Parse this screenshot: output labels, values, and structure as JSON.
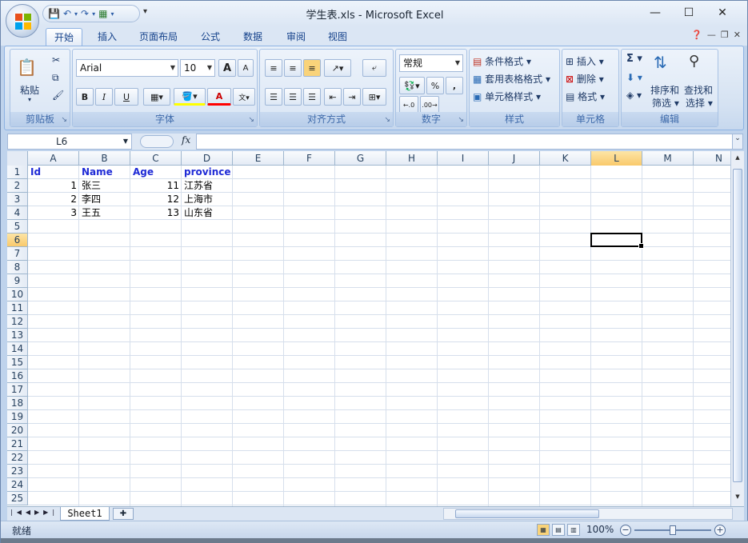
{
  "window": {
    "title": "学生表.xls - Microsoft Excel",
    "min": "—",
    "max": "☐",
    "close": "✕"
  },
  "ribbon": {
    "tabs": [
      "开始",
      "插入",
      "页面布局",
      "公式",
      "数据",
      "审阅",
      "视图"
    ],
    "active_tab": "开始",
    "groups": {
      "clipboard": {
        "label": "剪贴板",
        "paste": "粘贴"
      },
      "font": {
        "label": "字体",
        "font_name": "Arial",
        "font_size": "10",
        "bold": "B",
        "italic": "I",
        "underline": "U",
        "grow": "A",
        "shrink": "A",
        "font_color_letter": "A"
      },
      "alignment": {
        "label": "对齐方式"
      },
      "number": {
        "label": "数字",
        "format": "常规",
        "percent": "%",
        "comma": ","
      },
      "styles": {
        "label": "样式",
        "conditional": "条件格式",
        "table": "套用表格格式",
        "cell_styles": "单元格样式"
      },
      "cells": {
        "label": "单元格",
        "insert": "插入",
        "delete": "删除",
        "format": "格式"
      },
      "editing": {
        "label": "编辑",
        "sort": "排序和",
        "sort2": "筛选",
        "find": "查找和",
        "find2": "选择",
        "sigma": "Σ"
      }
    }
  },
  "formula_bar": {
    "name_box": "L6",
    "fx": "fx",
    "formula": ""
  },
  "sheet": {
    "columns": [
      "A",
      "B",
      "C",
      "D",
      "E",
      "F",
      "G",
      "H",
      "I",
      "J",
      "K",
      "L",
      "M",
      "N"
    ],
    "selected_column": "L",
    "row_numbers": [
      "1",
      "2",
      "3",
      "4",
      "5",
      "6",
      "7",
      "8",
      "9",
      "10",
      "11",
      "12",
      "13",
      "14",
      "15",
      "16",
      "17",
      "18",
      "19",
      "20",
      "21",
      "22",
      "23",
      "24",
      "25"
    ],
    "selected_row": "6",
    "header_row": [
      "Id",
      "Name",
      "Age",
      "province"
    ],
    "rows": [
      [
        "1",
        "张三",
        "11",
        "江苏省"
      ],
      [
        "2",
        "李四",
        "12",
        "上海市"
      ],
      [
        "3",
        "王五",
        "13",
        "山东省"
      ]
    ],
    "active_cell": "L6"
  },
  "sheet_tabs": {
    "tabs": [
      "Sheet1"
    ]
  },
  "status_bar": {
    "status": "就绪",
    "zoom": "100%"
  },
  "colors": {
    "header_text": "#1f2bd6",
    "selected_header": "#f9c96b",
    "ribbon_bg": "#d5e2f2"
  }
}
